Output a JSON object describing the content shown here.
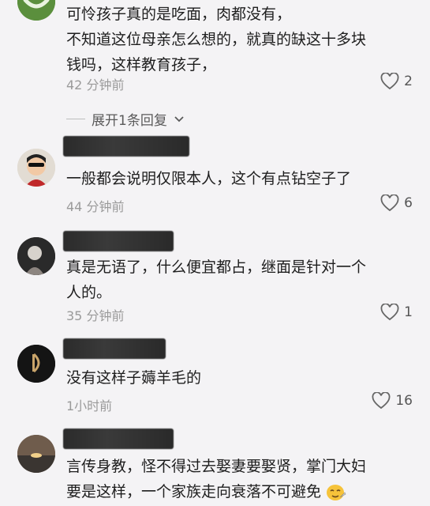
{
  "comments": [
    {
      "text_lines": [
        "可怜孩子真的是吃面，肉都没有，",
        "不知道这位母亲怎么想的，就真的缺这十多块",
        "钱吗，这样教育孩子，"
      ],
      "time": "42 分钟前",
      "likes": "2"
    },
    {
      "text_lines": [
        "一般都会说明仅限本人，这个有点钻空子了"
      ],
      "time": "44 分钟前",
      "likes": "6"
    },
    {
      "text_lines": [
        "真是无语了，什么便宜都占，继面是针对一个",
        "人的。"
      ],
      "time": "35 分钟前",
      "likes": "1"
    },
    {
      "text_lines": [
        "没有这样子薅羊毛的"
      ],
      "time": "1小时前",
      "likes": "16"
    },
    {
      "text_lines": [
        "言传身教，怪不得过去娶妻要娶贤，掌门大妇",
        "要是这样，一个家族走向衰落不可避免"
      ],
      "time": "",
      "likes": ""
    }
  ],
  "expand_replies": "展开1条回复",
  "icons": {
    "like": "heart-outline-icon",
    "chevron": "chevron-down-icon",
    "emoji": "emoji-face-icon"
  },
  "colors": {
    "background": "#f4f3f5",
    "muted_text": "#9a9a9a",
    "avatar1": "#4f8f3a"
  }
}
